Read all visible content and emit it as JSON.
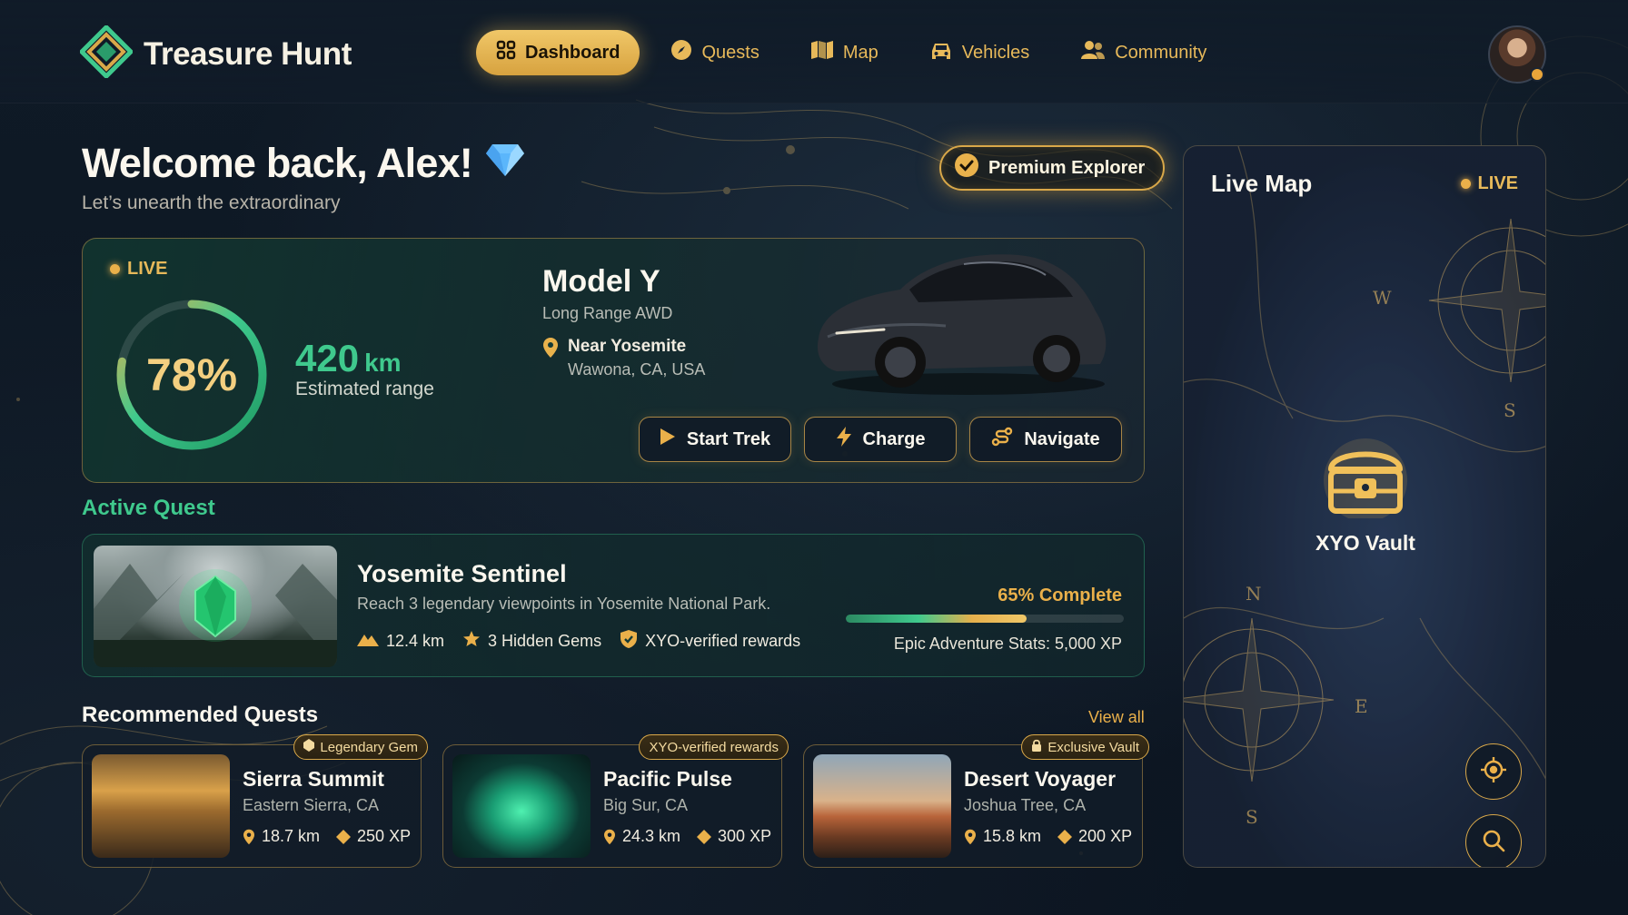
{
  "brand": {
    "title": "Treasure Hunt"
  },
  "nav": {
    "items": [
      {
        "label": "Dashboard",
        "icon": "grid-icon",
        "active": true
      },
      {
        "label": "Quests",
        "icon": "compass-icon",
        "active": false
      },
      {
        "label": "Map",
        "icon": "map-icon",
        "active": false
      },
      {
        "label": "Vehicles",
        "icon": "car-icon",
        "active": false
      },
      {
        "label": "Community",
        "icon": "users-icon",
        "active": false
      }
    ]
  },
  "welcome": {
    "title": "Welcome back, Alex!",
    "subtitle": "Let’s unearth the extraordinary",
    "premium_label": "Premium Explorer"
  },
  "vehicle": {
    "live_label": "LIVE",
    "battery_percent": 78,
    "battery_label": "78%",
    "range_value": "420",
    "range_unit": "km",
    "range_label": "Estimated range",
    "name": "Model Y",
    "variant": "Long Range AWD",
    "location_primary": "Near Yosemite",
    "location_secondary": "Wawona, CA, USA",
    "actions": [
      {
        "label": "Start Trek",
        "icon": "play-icon"
      },
      {
        "label": "Charge",
        "icon": "lightning-icon"
      },
      {
        "label": "Navigate",
        "icon": "route-icon"
      }
    ]
  },
  "active_quest": {
    "section_title": "Active Quest",
    "title": "Yosemite Sentinel",
    "description": "Reach 3 legendary viewpoints in Yosemite National Park.",
    "distance": "12.4 km",
    "gems": "3 Hidden Gems",
    "rewards": "XYO-verified rewards",
    "progress_percent": 65,
    "progress_label": "65% Complete",
    "xp_label": "Epic Adventure Stats: 5,000 XP"
  },
  "recommended": {
    "section_title": "Recommended Quests",
    "view_all": "View all",
    "cards": [
      {
        "title": "Sierra Summit",
        "location": "Eastern Sierra, CA",
        "distance": "18.7 km",
        "xp": "250 XP",
        "badge": "Legendary Gem",
        "badge_icon": "gem-icon"
      },
      {
        "title": "Pacific Pulse",
        "location": "Big Sur, CA",
        "distance": "24.3 km",
        "xp": "300 XP",
        "badge": "XYO-verified rewards",
        "badge_icon": ""
      },
      {
        "title": "Desert Voyager",
        "location": "Joshua Tree, CA",
        "distance": "15.8 km",
        "xp": "200 XP",
        "badge": "Exclusive Vault",
        "badge_icon": "lock-icon"
      }
    ]
  },
  "live_map": {
    "title": "Live Map",
    "live_label": "LIVE",
    "vault_label": "XYO Vault",
    "compass_letters": [
      "W",
      "S",
      "N",
      "E",
      "S"
    ]
  },
  "colors": {
    "accent_gold": "#eab04a",
    "accent_green": "#3fc98d",
    "background": "#0f1a26"
  }
}
